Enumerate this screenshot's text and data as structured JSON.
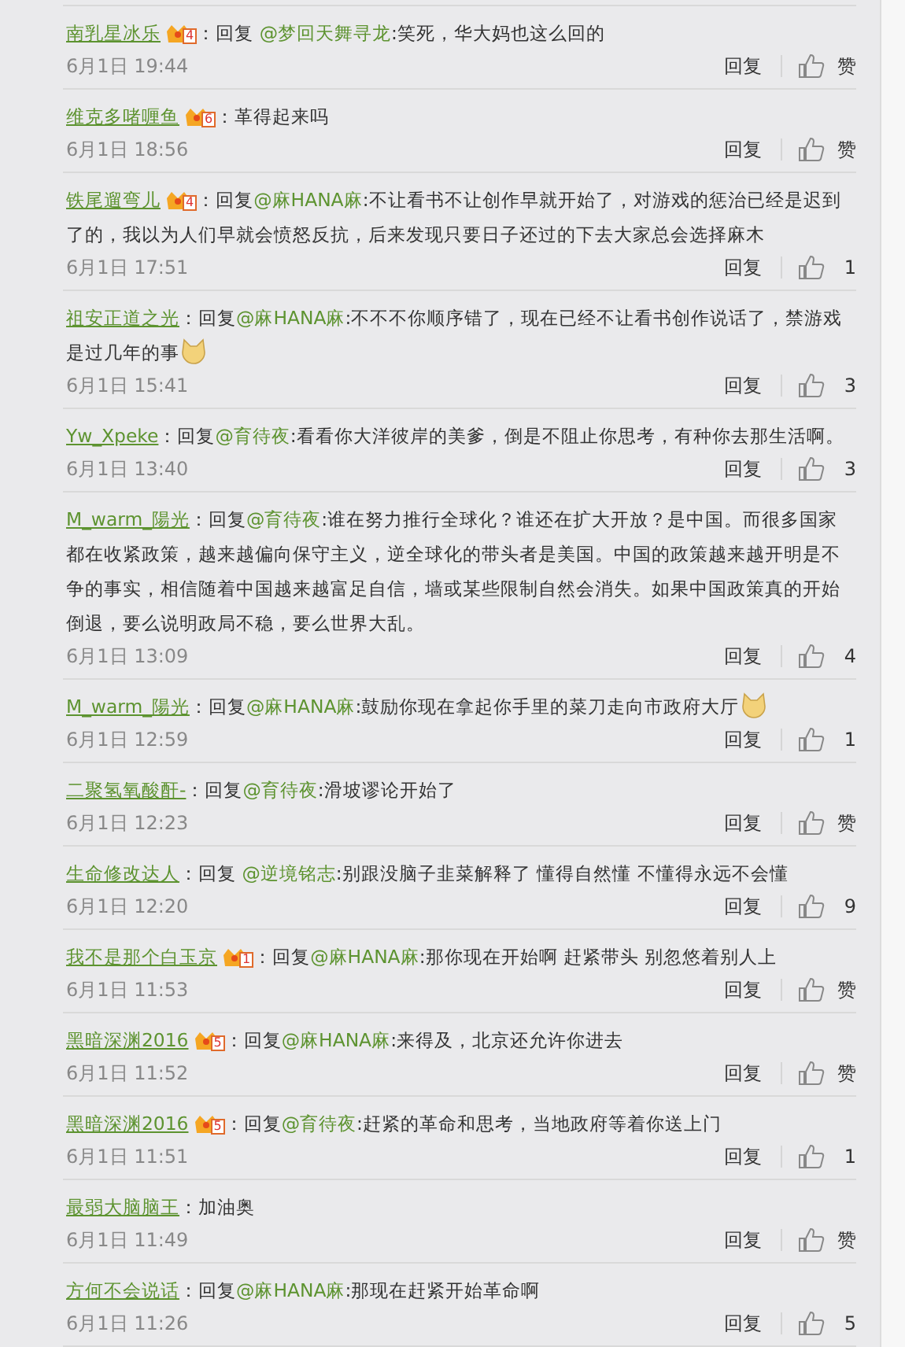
{
  "comments": [
    {
      "user": "南乳星冰乐",
      "badge": "4",
      "sep": "：",
      "body": {
        "lead": "回复 ",
        "mention": "@梦回天舞寻龙",
        "text": ":笑死，华大妈也这么回的"
      },
      "emoji": false,
      "time": "6月1日 19:44",
      "reply": "回复",
      "like": "赞"
    },
    {
      "user": "维克多啫喱鱼",
      "badge": "6",
      "sep": "：",
      "body": {
        "text": "革得起来吗"
      },
      "emoji": false,
      "time": "6月1日 18:56",
      "reply": "回复",
      "like": "赞"
    },
    {
      "user": "铁尾遛弯儿",
      "badge": "4",
      "sep": "：",
      "body": {
        "lead": "回复",
        "mention": "@麻HANA麻",
        "text": ":不让看书不让创作早就开始了，对游戏的惩治已经是迟到了的，我以为人们早就会愤怒反抗，后来发现只要日子还过的下去大家总会选择麻木"
      },
      "emoji": false,
      "time": "6月1日 17:51",
      "reply": "回复",
      "like": "1"
    },
    {
      "user": "祖安正道之光",
      "sep": "：",
      "body": {
        "lead": "回复",
        "mention": "@麻HANA麻",
        "text": ":不不不你顺序错了，现在已经不让看书创作说话了，禁游戏是过几年的事"
      },
      "emoji": true,
      "time": "6月1日 15:41",
      "reply": "回复",
      "like": "3"
    },
    {
      "user": "Yw_Xpeke",
      "sep": "：",
      "body": {
        "lead": "回复",
        "mention": "@育待夜",
        "text": ":看看你大洋彼岸的美爹，倒是不阻止你思考，有种你去那生活啊。"
      },
      "emoji": false,
      "time": "6月1日 13:40",
      "reply": "回复",
      "like": "3"
    },
    {
      "user": "M_warm_陽光",
      "sep": "：",
      "body": {
        "lead": "回复",
        "mention": "@育待夜",
        "text": ":谁在努力推行全球化？谁还在扩大开放？是中国。而很多国家都在收紧政策，越来越偏向保守主义，逆全球化的带头者是美国。中国的政策越来越开明是不争的事实，相信随着中国越来越富足自信，墙或某些限制自然会消失。如果中国政策真的开始倒退，要么说明政局不稳，要么世界大乱。"
      },
      "emoji": false,
      "time": "6月1日 13:09",
      "reply": "回复",
      "like": "4"
    },
    {
      "user": "M_warm_陽光",
      "sep": "：",
      "body": {
        "lead": "回复",
        "mention": "@麻HANA麻",
        "text": ":鼓励你现在拿起你手里的菜刀走向市政府大厅"
      },
      "emoji": true,
      "time": "6月1日 12:59",
      "reply": "回复",
      "like": "1"
    },
    {
      "user": "二聚氢氧酸酐-",
      "sep": "：",
      "body": {
        "lead": "回复",
        "mention": "@育待夜",
        "text": ":滑坡谬论开始了"
      },
      "emoji": false,
      "time": "6月1日 12:23",
      "reply": "回复",
      "like": "赞"
    },
    {
      "user": "生命修改达人",
      "sep": "：",
      "body": {
        "lead": "回复 ",
        "mention": "@逆境铭志",
        "text": ":别跟没脑子韭菜解释了 懂得自然懂 不懂得永远不会懂"
      },
      "emoji": false,
      "time": "6月1日 12:20",
      "reply": "回复",
      "like": "9"
    },
    {
      "user": "我不是那个白玉京",
      "badge": "1",
      "sep": "：",
      "body": {
        "lead": "回复",
        "mention": "@麻HANA麻",
        "text": ":那你现在开始啊 赶紧带头 别忽悠着别人上"
      },
      "emoji": false,
      "time": "6月1日 11:53",
      "reply": "回复",
      "like": "赞"
    },
    {
      "user": "黑暗深渊2016",
      "badge": "5",
      "sep": "：",
      "body": {
        "lead": "回复",
        "mention": "@麻HANA麻",
        "text": ":来得及，北京还允许你进去"
      },
      "emoji": false,
      "time": "6月1日 11:52",
      "reply": "回复",
      "like": "赞"
    },
    {
      "user": "黑暗深渊2016",
      "badge": "5",
      "sep": "：",
      "body": {
        "lead": "回复",
        "mention": "@育待夜",
        "text": ":赶紧的革命和思考，当地政府等着你送上门"
      },
      "emoji": false,
      "time": "6月1日 11:51",
      "reply": "回复",
      "like": "1"
    },
    {
      "user": "最弱大脑脑王",
      "sep": "：",
      "body": {
        "text": "加油奥"
      },
      "emoji": false,
      "time": "6月1日 11:49",
      "reply": "回复",
      "like": "赞"
    },
    {
      "user": "方何不会说话",
      "sep": "：",
      "body": {
        "lead": "回复",
        "mention": "@麻HANA麻",
        "text": ":那现在赶紧开始革命啊"
      },
      "emoji": false,
      "time": "6月1日 11:26",
      "reply": "回复",
      "like": "5"
    }
  ]
}
